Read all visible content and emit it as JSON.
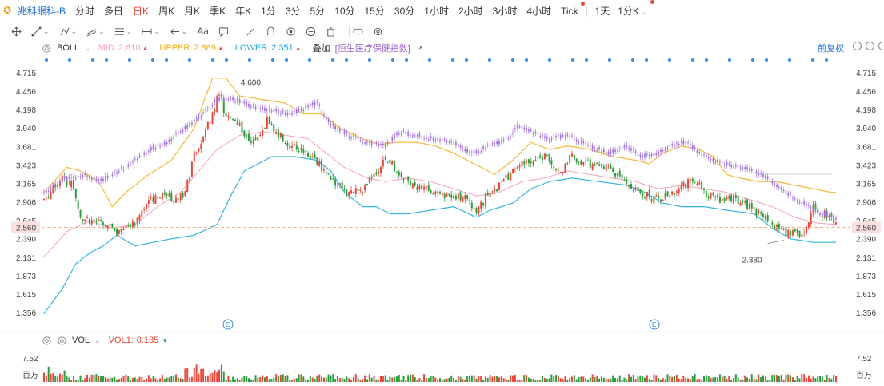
{
  "top_bar": {
    "stock_name": "兆科眼科-B",
    "periods": [
      {
        "label": "分时",
        "active": false
      },
      {
        "label": "多日",
        "active": false
      },
      {
        "label": "日K",
        "active": true
      },
      {
        "label": "周K",
        "active": false
      },
      {
        "label": "月K",
        "active": false
      },
      {
        "label": "季K",
        "active": false
      },
      {
        "label": "年K",
        "active": false
      },
      {
        "label": "1分",
        "active": false
      },
      {
        "label": "3分",
        "active": false
      },
      {
        "label": "5分",
        "active": false
      },
      {
        "label": "10分",
        "active": false
      },
      {
        "label": "15分",
        "active": false
      },
      {
        "label": "30分",
        "active": false
      },
      {
        "label": "1小时",
        "active": false
      },
      {
        "label": "2小时",
        "active": false
      },
      {
        "label": "3小时",
        "active": false
      },
      {
        "label": "4小时",
        "active": false
      },
      {
        "label": "Tick",
        "active": false,
        "dot": true
      }
    ],
    "custom_period": "1天 : 1分K"
  },
  "toolbar": {
    "icons": [
      "move-icon",
      "line-icon",
      "ray-icon",
      "channel-icon",
      "fib-icon",
      "measure-icon",
      "arrow-icon",
      "text-icon",
      "note-icon",
      "pen-icon",
      "shape-icon",
      "eraser-icon",
      "trash-icon",
      "magnet-icon",
      "settings-icon"
    ],
    "text_tool": "Aa"
  },
  "indicator": {
    "name": "BOLL",
    "mid_label": "MID:",
    "mid_value": "2.610",
    "upper_label": "UPPER:",
    "upper_value": "2.869",
    "lower_label": "LOWER:",
    "lower_value": "2.351",
    "overlay_label": "叠加",
    "overlay_name": "[恒生医疗保健指数]",
    "close": "×",
    "adjust": "前复权"
  },
  "volume": {
    "name": "VOL",
    "vol1_label": "VOL1:",
    "vol1_value": "0.135",
    "top_tick": "7.52",
    "unit": "百万"
  },
  "chart_data": {
    "type": "candlestick",
    "y_ticks": [
      "4.715",
      "4.456",
      "4.198",
      "3.940",
      "3.681",
      "3.423",
      "3.165",
      "2.906",
      "2.645",
      "2.390",
      "2.131",
      "1.873",
      "1.615",
      "1.356"
    ],
    "current_price": "2.560",
    "annotations": {
      "high_label": "4.600",
      "low_label": "2.380"
    },
    "event_markers": [
      "E",
      "E"
    ],
    "colors": {
      "up": "#e8463a",
      "down": "#2a9d3a",
      "overlay": "#a06ee0",
      "upper": "#f4b83a",
      "mid": "#f4a3b8",
      "lower": "#36b4e0",
      "price_line": "#f5b38a"
    },
    "anchors": [
      [
        0,
        2.95
      ],
      [
        8,
        3.25
      ],
      [
        12,
        3.15
      ],
      [
        16,
        2.7
      ],
      [
        22,
        2.65
      ],
      [
        28,
        2.6
      ],
      [
        33,
        2.48
      ],
      [
        38,
        2.55
      ],
      [
        45,
        2.9
      ],
      [
        52,
        3.05
      ],
      [
        58,
        2.95
      ],
      [
        62,
        3.05
      ],
      [
        66,
        3.6
      ],
      [
        70,
        3.8
      ],
      [
        74,
        4.15
      ],
      [
        77,
        4.45
      ],
      [
        80,
        4.1
      ],
      [
        86,
        4.0
      ],
      [
        90,
        3.75
      ],
      [
        94,
        3.8
      ],
      [
        98,
        4.05
      ],
      [
        102,
        3.9
      ],
      [
        106,
        3.75
      ],
      [
        112,
        3.65
      ],
      [
        118,
        3.55
      ],
      [
        122,
        3.4
      ],
      [
        126,
        3.25
      ],
      [
        132,
        3.1
      ],
      [
        138,
        3.05
      ],
      [
        142,
        3.15
      ],
      [
        146,
        3.35
      ],
      [
        150,
        3.55
      ],
      [
        154,
        3.4
      ],
      [
        160,
        3.2
      ],
      [
        166,
        3.1
      ],
      [
        172,
        3.05
      ],
      [
        178,
        3.0
      ],
      [
        186,
        2.95
      ],
      [
        190,
        2.8
      ],
      [
        196,
        3.05
      ],
      [
        202,
        3.2
      ],
      [
        208,
        3.4
      ],
      [
        214,
        3.5
      ],
      [
        220,
        3.55
      ],
      [
        226,
        3.3
      ],
      [
        232,
        3.55
      ],
      [
        238,
        3.45
      ],
      [
        244,
        3.45
      ],
      [
        250,
        3.35
      ],
      [
        256,
        3.15
      ],
      [
        262,
        3.05
      ],
      [
        268,
        2.95
      ],
      [
        274,
        3.0
      ],
      [
        280,
        3.15
      ],
      [
        286,
        3.2
      ],
      [
        292,
        3.0
      ],
      [
        298,
        2.95
      ],
      [
        304,
        2.95
      ],
      [
        310,
        2.85
      ],
      [
        316,
        2.7
      ],
      [
        322,
        2.55
      ],
      [
        328,
        2.45
      ],
      [
        334,
        2.5
      ],
      [
        338,
        2.85
      ],
      [
        343,
        2.75
      ],
      [
        348,
        2.6
      ]
    ],
    "overlay_anchors": [
      [
        0,
        3.05
      ],
      [
        10,
        3.25
      ],
      [
        18,
        3.3
      ],
      [
        24,
        3.2
      ],
      [
        30,
        3.3
      ],
      [
        38,
        3.45
      ],
      [
        46,
        3.65
      ],
      [
        54,
        3.75
      ],
      [
        60,
        3.9
      ],
      [
        68,
        4.1
      ],
      [
        76,
        4.35
      ],
      [
        84,
        4.35
      ],
      [
        92,
        4.25
      ],
      [
        100,
        4.2
      ],
      [
        108,
        4.15
      ],
      [
        116,
        4.25
      ],
      [
        120,
        4.3
      ],
      [
        126,
        4.0
      ],
      [
        134,
        3.85
      ],
      [
        142,
        3.75
      ],
      [
        150,
        3.7
      ],
      [
        156,
        3.9
      ],
      [
        164,
        3.85
      ],
      [
        172,
        3.8
      ],
      [
        180,
        3.75
      ],
      [
        188,
        3.6
      ],
      [
        196,
        3.7
      ],
      [
        204,
        3.8
      ],
      [
        208,
        3.98
      ],
      [
        214,
        3.9
      ],
      [
        222,
        3.8
      ],
      [
        230,
        3.85
      ],
      [
        240,
        3.7
      ],
      [
        248,
        3.6
      ],
      [
        256,
        3.7
      ],
      [
        262,
        3.55
      ],
      [
        270,
        3.6
      ],
      [
        276,
        3.7
      ],
      [
        282,
        3.76
      ],
      [
        288,
        3.6
      ],
      [
        294,
        3.5
      ],
      [
        300,
        3.45
      ],
      [
        306,
        3.4
      ],
      [
        312,
        3.35
      ],
      [
        318,
        3.25
      ],
      [
        326,
        3.05
      ],
      [
        334,
        2.9
      ],
      [
        342,
        2.75
      ],
      [
        348,
        2.7
      ]
    ],
    "upper": [
      [
        0,
        3.05
      ],
      [
        10,
        3.4
      ],
      [
        16,
        3.35
      ],
      [
        24,
        3.2
      ],
      [
        30,
        2.85
      ],
      [
        36,
        3.05
      ],
      [
        46,
        3.3
      ],
      [
        56,
        3.5
      ],
      [
        66,
        3.95
      ],
      [
        74,
        4.65
      ],
      [
        80,
        4.65
      ],
      [
        86,
        4.4
      ],
      [
        96,
        4.35
      ],
      [
        106,
        4.3
      ],
      [
        114,
        4.15
      ],
      [
        122,
        4.15
      ],
      [
        130,
        3.95
      ],
      [
        140,
        3.8
      ],
      [
        148,
        3.72
      ],
      [
        154,
        3.75
      ],
      [
        164,
        3.75
      ],
      [
        172,
        3.7
      ],
      [
        180,
        3.6
      ],
      [
        186,
        3.5
      ],
      [
        192,
        3.4
      ],
      [
        198,
        3.3
      ],
      [
        206,
        3.5
      ],
      [
        214,
        3.75
      ],
      [
        222,
        3.65
      ],
      [
        230,
        3.7
      ],
      [
        240,
        3.65
      ],
      [
        250,
        3.55
      ],
      [
        260,
        3.5
      ],
      [
        266,
        3.45
      ],
      [
        272,
        3.6
      ],
      [
        280,
        3.7
      ],
      [
        288,
        3.65
      ],
      [
        294,
        3.55
      ],
      [
        300,
        3.3
      ],
      [
        306,
        3.25
      ],
      [
        314,
        3.2
      ],
      [
        322,
        3.2
      ],
      [
        330,
        3.15
      ],
      [
        338,
        3.1
      ],
      [
        346,
        3.05
      ]
    ],
    "mid": [
      [
        0,
        2.15
      ],
      [
        10,
        2.5
      ],
      [
        20,
        2.65
      ],
      [
        30,
        2.55
      ],
      [
        40,
        2.6
      ],
      [
        50,
        2.85
      ],
      [
        60,
        3.05
      ],
      [
        68,
        3.35
      ],
      [
        76,
        3.65
      ],
      [
        86,
        3.85
      ],
      [
        96,
        3.9
      ],
      [
        106,
        3.85
      ],
      [
        116,
        3.8
      ],
      [
        124,
        3.6
      ],
      [
        132,
        3.4
      ],
      [
        142,
        3.25
      ],
      [
        150,
        3.2
      ],
      [
        160,
        3.25
      ],
      [
        170,
        3.2
      ],
      [
        180,
        3.1
      ],
      [
        190,
        3.0
      ],
      [
        200,
        3.05
      ],
      [
        210,
        3.2
      ],
      [
        220,
        3.25
      ],
      [
        230,
        3.35
      ],
      [
        240,
        3.3
      ],
      [
        250,
        3.25
      ],
      [
        260,
        3.2
      ],
      [
        270,
        3.1
      ],
      [
        280,
        3.15
      ],
      [
        290,
        3.1
      ],
      [
        300,
        3.05
      ],
      [
        310,
        2.95
      ],
      [
        320,
        2.85
      ],
      [
        330,
        2.7
      ],
      [
        340,
        2.62
      ],
      [
        348,
        2.6
      ]
    ],
    "lower": [
      [
        0,
        1.35
      ],
      [
        8,
        1.7
      ],
      [
        14,
        2.05
      ],
      [
        20,
        2.2
      ],
      [
        26,
        2.3
      ],
      [
        32,
        2.45
      ],
      [
        40,
        2.3
      ],
      [
        48,
        2.35
      ],
      [
        56,
        2.4
      ],
      [
        66,
        2.45
      ],
      [
        76,
        2.6
      ],
      [
        82,
        3.0
      ],
      [
        88,
        3.35
      ],
      [
        94,
        3.45
      ],
      [
        100,
        3.55
      ],
      [
        110,
        3.55
      ],
      [
        120,
        3.5
      ],
      [
        126,
        3.35
      ],
      [
        132,
        3.05
      ],
      [
        140,
        2.85
      ],
      [
        146,
        2.85
      ],
      [
        152,
        2.75
      ],
      [
        160,
        2.75
      ],
      [
        170,
        2.8
      ],
      [
        180,
        2.85
      ],
      [
        190,
        2.7
      ],
      [
        196,
        2.8
      ],
      [
        206,
        2.9
      ],
      [
        214,
        3.1
      ],
      [
        222,
        3.2
      ],
      [
        232,
        3.25
      ],
      [
        244,
        3.2
      ],
      [
        256,
        3.15
      ],
      [
        264,
        3.05
      ],
      [
        272,
        2.9
      ],
      [
        280,
        2.85
      ],
      [
        290,
        2.85
      ],
      [
        300,
        2.8
      ],
      [
        312,
        2.75
      ],
      [
        320,
        2.55
      ],
      [
        328,
        2.4
      ],
      [
        338,
        2.35
      ],
      [
        346,
        2.35
      ]
    ]
  }
}
